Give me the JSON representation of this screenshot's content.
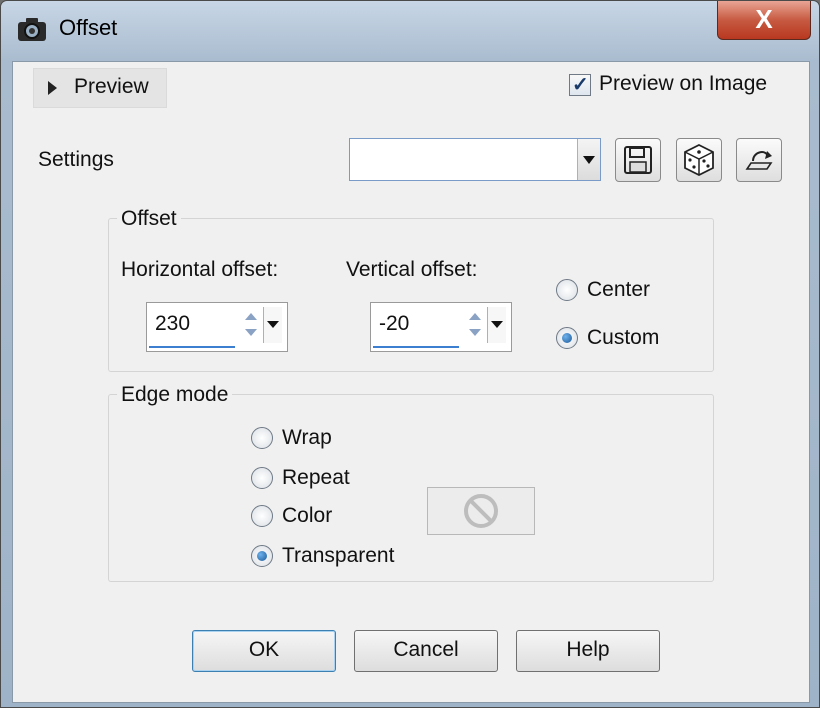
{
  "window": {
    "title": "Offset",
    "close_label": "X"
  },
  "preview": {
    "toggle_label": "Preview",
    "preview_on_image_label": "Preview on Image",
    "preview_on_image_checked": true
  },
  "settings": {
    "label": "Settings",
    "combo_value": ""
  },
  "offset_group": {
    "title": "Offset",
    "horizontal_label": "Horizontal offset:",
    "horizontal_value": "230",
    "vertical_label": "Vertical offset:",
    "vertical_value": "-20",
    "mode_options": [
      {
        "label": "Center",
        "selected": false
      },
      {
        "label": "Custom",
        "selected": true
      }
    ]
  },
  "edge_group": {
    "title": "Edge mode",
    "options": [
      {
        "label": "Wrap",
        "selected": false
      },
      {
        "label": "Repeat",
        "selected": false
      },
      {
        "label": "Color",
        "selected": false
      },
      {
        "label": "Transparent",
        "selected": true
      }
    ]
  },
  "buttons": {
    "ok": "OK",
    "cancel": "Cancel",
    "help": "Help"
  },
  "icons": [
    "camera-icon",
    "save-preset-icon",
    "randomize-dice-icon",
    "reset-icon",
    "no-color-icon"
  ],
  "colors": {
    "accent": "#3c7fd0",
    "close": "#c75a42",
    "dialog_bg": "#f0f0f0"
  }
}
